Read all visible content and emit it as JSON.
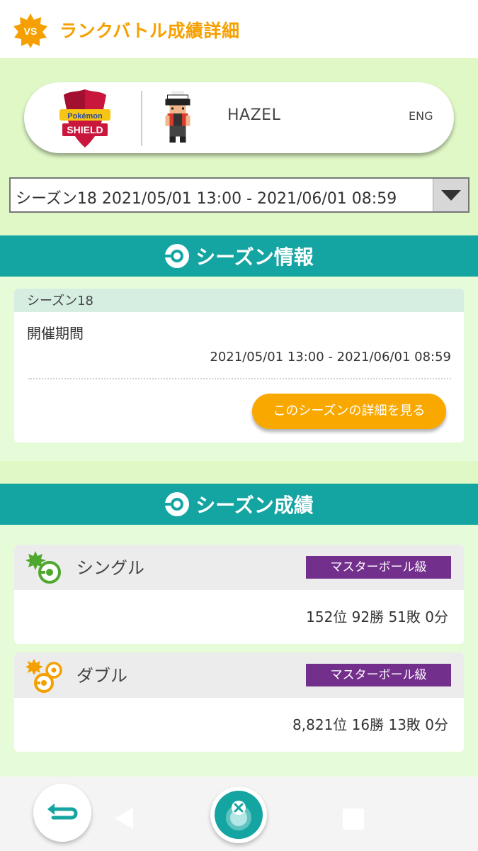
{
  "header": {
    "badge": "VS",
    "title": "ランクバトル成績詳細"
  },
  "trainer": {
    "name": "HAZEL",
    "language": "ENG",
    "game_logo_text": "SHIELD"
  },
  "season_select": {
    "selected": "シーズン18 2021/05/01 13:00 - 2021/06/01 08:59"
  },
  "season_info": {
    "section_title": "シーズン情報",
    "season_name": "シーズン18",
    "period_label": "開催期間",
    "period": "2021/05/01 13:00 - 2021/06/01 08:59",
    "detail_button": "このシーズンの詳細を見る"
  },
  "season_results": {
    "section_title": "シーズン成績",
    "single": {
      "name": "シングル",
      "rank_class": "マスターボール級",
      "result": "152位 92勝 51敗 0分"
    },
    "double": {
      "name": "ダブル",
      "rank_class": "マスターボール級",
      "result": "8,821位 16勝 13敗 0分"
    }
  },
  "colors": {
    "accent_orange": "#f5a000",
    "teal": "#14a5a2",
    "master_purple": "#732f8c"
  },
  "icons": [
    "vs-badge-icon",
    "pokemon-shield-logo",
    "trainer-sprite",
    "pokeball-icon",
    "single-battle-icon",
    "double-battle-icon",
    "back-icon",
    "home-icon"
  ]
}
